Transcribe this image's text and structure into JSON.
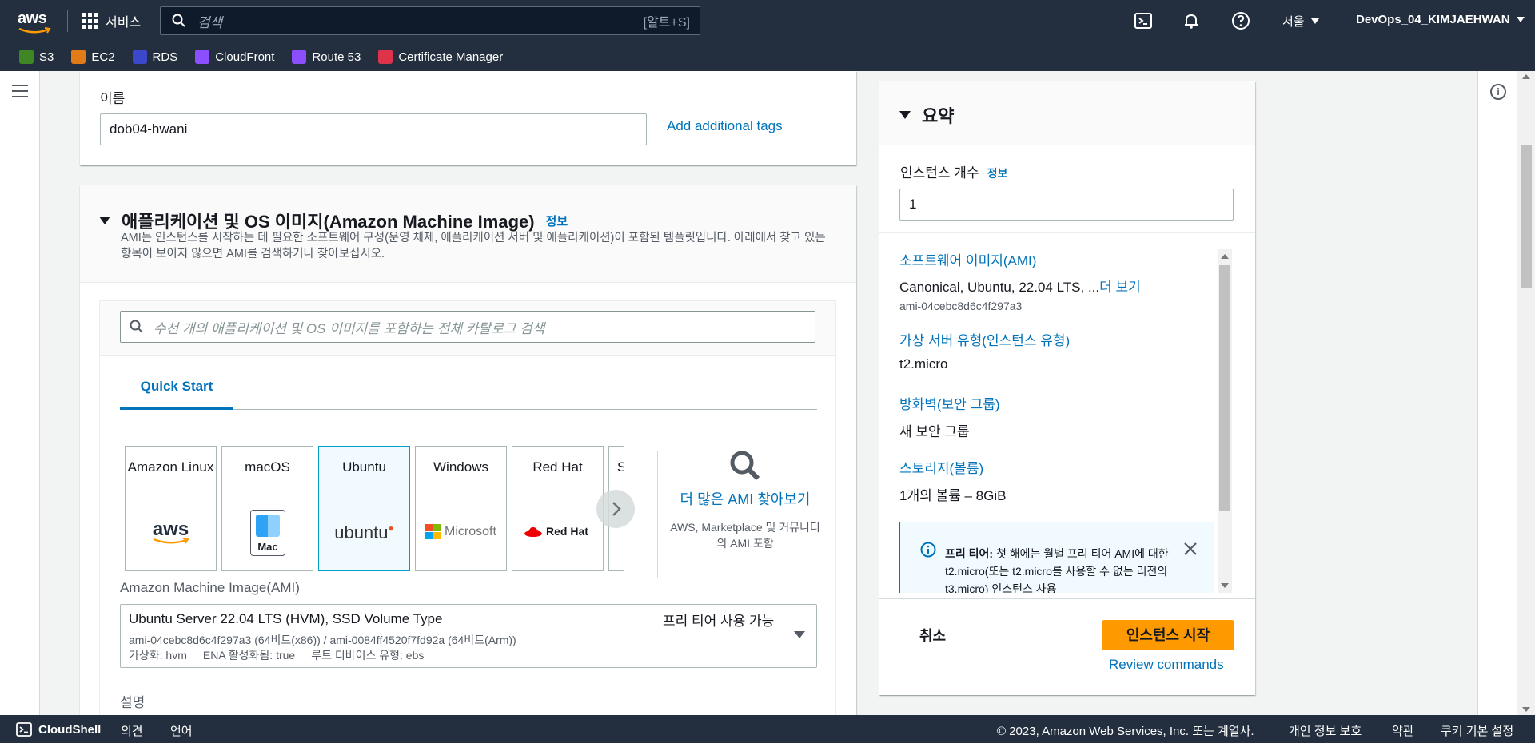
{
  "topnav": {
    "logo": "aws",
    "services_label": "서비스",
    "search_placeholder": "검색",
    "search_shortcut": "[알트+S]",
    "region": "서울",
    "account": "DevOps_04_KIMJAEHWAN"
  },
  "favorites": [
    {
      "label": "S3",
      "color": "#3f8624"
    },
    {
      "label": "EC2",
      "color": "#e07b17"
    },
    {
      "label": "RDS",
      "color": "#3b48cc"
    },
    {
      "label": "CloudFront",
      "color": "#8c4fff"
    },
    {
      "label": "Route 53",
      "color": "#8c4fff"
    },
    {
      "label": "Certificate Manager",
      "color": "#dd344c"
    }
  ],
  "name_section": {
    "label": "이름",
    "value": "dob04-hwani",
    "add_tags": "Add additional tags"
  },
  "ami_section": {
    "title": "애플리케이션 및 OS 이미지(Amazon Machine Image)",
    "info": "정보",
    "description": "AMI는 인스턴스를 시작하는 데 필요한 소프트웨어 구성(운영 체제, 애플리케이션 서버 및 애플리케이션)이 포함된 템플릿입니다. 아래에서 찾고 있는 항목이 보이지 않으면 AMI를 검색하거나 찾아보십시오.",
    "search_placeholder": "수천 개의 애플리케이션 및 OS 이미지를 포함하는 전체 카탈로그 검색",
    "tab_quick_start": "Quick Start",
    "cards": [
      {
        "name": "Amazon Linux",
        "logo": "aws"
      },
      {
        "name": "macOS",
        "logo": "Mac"
      },
      {
        "name": "Ubuntu",
        "logo": "ubuntu"
      },
      {
        "name": "Windows",
        "logo": "Microsoft"
      },
      {
        "name": "Red Hat",
        "logo": "Red Hat"
      },
      {
        "name": "S",
        "logo": ""
      }
    ],
    "more_ami": "더 많은 AMI 찾아보기",
    "more_ami_sub": "AWS, Marketplace 및 커뮤니티의 AMI 포함",
    "ami_label": "Amazon Machine Image(AMI)",
    "selected_ami": {
      "name": "Ubuntu Server 22.04 LTS (HVM), SSD Volume Type",
      "badge": "프리 티어 사용 가능",
      "ids": "ami-04cebc8d6c4f297a3 (64비트(x86)) / ami-0084ff4520f7fd92a (64비트(Arm))",
      "virt": "가상화: hvm",
      "ena": "ENA 활성화됨: true",
      "root": "루트 디바이스 유형: ebs"
    },
    "description_label": "설명"
  },
  "summary": {
    "title": "요약",
    "instance_count_label": "인스턴스 개수",
    "instance_count_info": "정보",
    "instance_count": "1",
    "software_image_label": "소프트웨어 이미지(AMI)",
    "software_image_value": "Canonical, Ubuntu, 22.04 LTS, ...",
    "more": "더 보기",
    "ami_id": "ami-04cebc8d6c4f297a3",
    "instance_type_label": "가상 서버 유형(인스턴스 유형)",
    "instance_type_value": "t2.micro",
    "firewall_label": "방화벽(보안 그룹)",
    "firewall_value": "새 보안 그룹",
    "storage_label": "스토리지(볼륨)",
    "storage_value": "1개의 볼륨 – 8GiB",
    "free_tier_bold": "프리 티어:",
    "free_tier_text": "첫 해에는 월별 프리 티어 AMI에 대한 t2.micro(또는 t2.micro를 사용할 수 없는 리전의 t3.micro) 인스턴스 사용",
    "cancel": "취소",
    "launch": "인스턴스 시작",
    "review": "Review commands"
  },
  "footer": {
    "cloudshell": "CloudShell",
    "feedback": "의견",
    "language": "언어",
    "copyright": "© 2023, Amazon Web Services, Inc. 또는 계열사.",
    "privacy": "개인 정보 보호",
    "terms": "약관",
    "cookies": "쿠키 기본 설정"
  },
  "colors": {
    "nav_bg": "#232f3e",
    "link": "#0073bb",
    "primary_button": "#ff9900",
    "selected_card_bg": "#f1faff"
  }
}
